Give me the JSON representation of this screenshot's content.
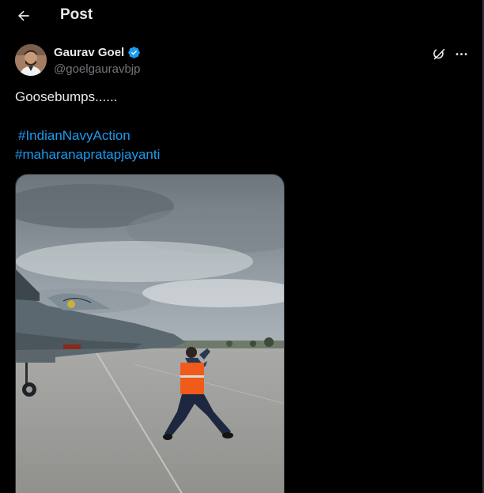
{
  "header": {
    "back_icon": "arrow-left-icon",
    "title": "Post"
  },
  "post": {
    "author": {
      "name": "Gaurav Goel",
      "handle": "@goelgauravbjp",
      "verified": true,
      "verified_color": "#1d9bf0"
    },
    "text": "Goosebumps......",
    "hashtags": [
      "#IndianNavyAction",
      "#maharanapratapjayanti"
    ],
    "action_icons": [
      "grok-icon",
      "more-horizontal-icon"
    ]
  },
  "colors": {
    "background": "#000000",
    "text_primary": "#e7e9ea",
    "text_secondary": "#71767b",
    "link": "#1d9bf0"
  }
}
